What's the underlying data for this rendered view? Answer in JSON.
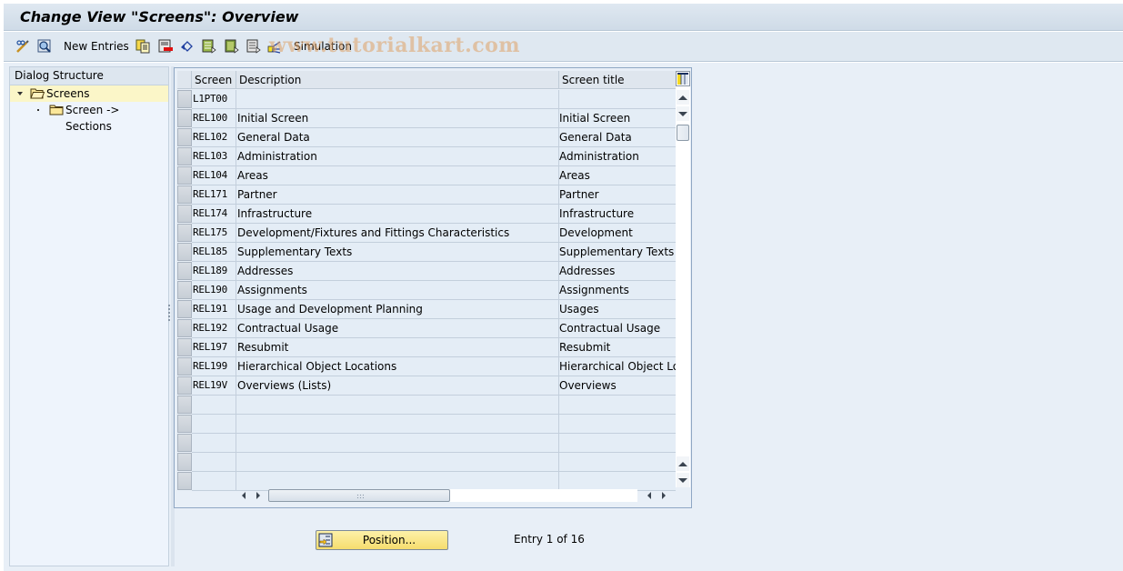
{
  "window": {
    "title": "Change View \"Screens\": Overview"
  },
  "toolbar": {
    "items": [
      {
        "icon": "edit-glasses-icon",
        "label": ""
      },
      {
        "icon": "details-icon",
        "label": ""
      },
      {
        "icon": "",
        "label": "New Entries"
      },
      {
        "icon": "copy-icon",
        "label": ""
      },
      {
        "icon": "delete-icon",
        "label": ""
      },
      {
        "icon": "undo-icon",
        "label": ""
      },
      {
        "icon": "select-all-icon",
        "label": ""
      },
      {
        "icon": "select-block-icon",
        "label": ""
      },
      {
        "icon": "deselect-all-icon",
        "label": ""
      },
      {
        "icon": "transport-icon",
        "label": ""
      },
      {
        "icon": "",
        "label": "Simulation"
      }
    ],
    "new_entries_label": "New Entries",
    "simulation_label": "Simulation"
  },
  "watermark": "www.tutorialkart.com",
  "dialog_structure": {
    "header": "Dialog Structure",
    "nodes": [
      {
        "label": "Screens",
        "level": 0,
        "expanded": true,
        "selected": true,
        "icon": "folder-open-icon"
      },
      {
        "label": "Screen -> Sections",
        "level": 1,
        "expanded": false,
        "selected": false,
        "icon": "folder-icon"
      }
    ]
  },
  "table": {
    "columns": [
      "Screen",
      "Description",
      "Screen title"
    ],
    "rows": [
      {
        "screen": "L1PT00",
        "description": "",
        "title": ""
      },
      {
        "screen": "REL100",
        "description": "Initial Screen",
        "title": "Initial Screen"
      },
      {
        "screen": "REL102",
        "description": "General Data",
        "title": "General Data"
      },
      {
        "screen": "REL103",
        "description": "Administration",
        "title": "Administration"
      },
      {
        "screen": "REL104",
        "description": "Areas",
        "title": "Areas"
      },
      {
        "screen": "REL171",
        "description": "Partner",
        "title": "Partner"
      },
      {
        "screen": "REL174",
        "description": "Infrastructure",
        "title": "Infrastructure"
      },
      {
        "screen": "REL175",
        "description": "Development/Fixtures and Fittings Characteristics",
        "title": "Development"
      },
      {
        "screen": "REL185",
        "description": "Supplementary Texts",
        "title": "Supplementary Texts"
      },
      {
        "screen": "REL189",
        "description": "Addresses",
        "title": "Addresses"
      },
      {
        "screen": "REL190",
        "description": "Assignments",
        "title": "Assignments"
      },
      {
        "screen": "REL191",
        "description": "Usage and Development Planning",
        "title": "Usages"
      },
      {
        "screen": "REL192",
        "description": "Contractual Usage",
        "title": "Contractual Usage"
      },
      {
        "screen": "REL197",
        "description": "Resubmit",
        "title": "Resubmit"
      },
      {
        "screen": "REL199",
        "description": "Hierarchical Object Locations",
        "title": "Hierarchical Object Loc"
      },
      {
        "screen": "REL19V",
        "description": "Overviews (Lists)",
        "title": "Overviews"
      },
      {
        "screen": "",
        "description": "",
        "title": ""
      },
      {
        "screen": "",
        "description": "",
        "title": ""
      },
      {
        "screen": "",
        "description": "",
        "title": ""
      },
      {
        "screen": "",
        "description": "",
        "title": ""
      },
      {
        "screen": "",
        "description": "",
        "title": ""
      }
    ]
  },
  "footer": {
    "position_button": "Position...",
    "entry_info": "Entry 1 of 16"
  },
  "colors": {
    "header_bg": "#dfe8f1",
    "selected_node_bg": "#fbf6c8",
    "row_bg": "#e4edf6",
    "position_btn": "#f6dd6e"
  }
}
